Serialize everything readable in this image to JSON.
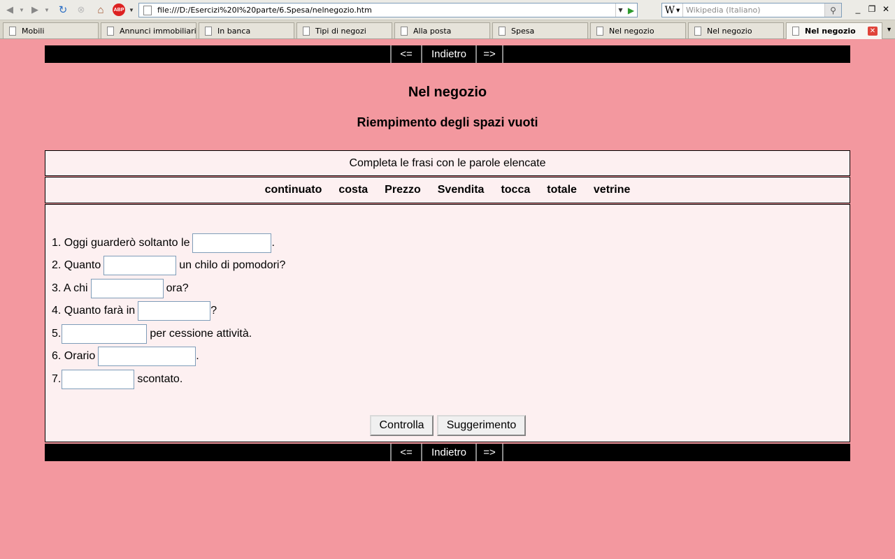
{
  "browser": {
    "url": "file:///D:/Esercizi%20I%20parte/6.Spesa/nelnegozio.htm",
    "search_placeholder": "Wikipedia (Italiano)",
    "search_engine": "W",
    "adblock_label": "ABP",
    "tabs": [
      {
        "label": "Mobili"
      },
      {
        "label": "Annunci immobiliari"
      },
      {
        "label": "In banca"
      },
      {
        "label": "Tipi di negozi"
      },
      {
        "label": "Alla posta"
      },
      {
        "label": "Spesa"
      },
      {
        "label": "Nel negozio"
      },
      {
        "label": "Nel negozio"
      },
      {
        "label": "Nel negozio"
      }
    ]
  },
  "nav": {
    "prev_label": "<=",
    "back_label": "Indietro",
    "next_label": "=>"
  },
  "page": {
    "title": "Nel negozio",
    "subtitle": "Riempimento degli spazi vuoti",
    "instruction": "Completa le frasi con le parole elencate",
    "words": [
      "continuato",
      "costa",
      "Prezzo",
      "Svendita",
      "tocca",
      "totale",
      "vetrine"
    ],
    "questions": [
      {
        "before": "1. Oggi guarderò soltanto le",
        "after": "."
      },
      {
        "before": "2. Quanto",
        "after": "un chilo di pomodori?"
      },
      {
        "before": "3. A chi",
        "after": "ora?"
      },
      {
        "before": "4. Quanto farà in",
        "after": "?"
      },
      {
        "before": "5.",
        "after": "per cessione attività."
      },
      {
        "before": "6. Orario",
        "after": "."
      },
      {
        "before": "7.",
        "after": "scontato."
      }
    ],
    "check_label": "Controlla",
    "hint_label": "Suggerimento"
  }
}
